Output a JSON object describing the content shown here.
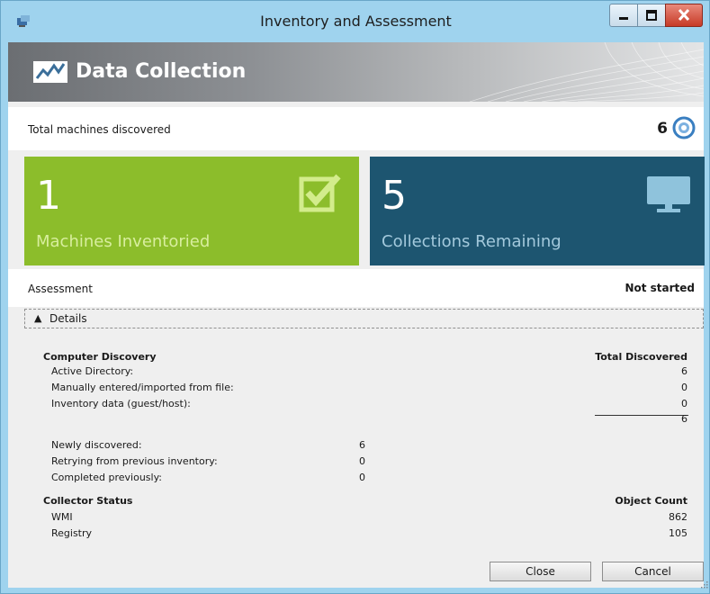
{
  "window": {
    "title": "Inventory and Assessment",
    "icon": "app-icon",
    "controls": [
      "minimize-icon",
      "maximize-icon",
      "close-icon"
    ]
  },
  "header": {
    "title": "Data Collection",
    "icon": "chart-icon"
  },
  "summary": {
    "label": "Total machines discovered",
    "value": "6",
    "icon": "spinner-icon"
  },
  "tiles": [
    {
      "number": "1",
      "label": "Machines Inventoried",
      "icon": "checkbox-icon",
      "color": "#8cbd2b"
    },
    {
      "number": "5",
      "label": "Collections Remaining",
      "icon": "monitor-icon",
      "color": "#1d5570"
    }
  ],
  "assessment": {
    "label": "Assessment",
    "value": "Not started"
  },
  "details": {
    "toggle_label": "Details",
    "discovery": {
      "title": "Computer Discovery",
      "total_header": "Total Discovered",
      "rows": [
        {
          "label": "Active Directory:",
          "value": "6"
        },
        {
          "label": "Manually entered/imported from file:",
          "value": "0"
        },
        {
          "label": "Inventory data (guest/host):",
          "value": "0"
        }
      ],
      "total": "6"
    },
    "status": [
      {
        "label": "Newly discovered:",
        "value": "6"
      },
      {
        "label": "Retrying from previous inventory:",
        "value": "0"
      },
      {
        "label": "Completed previously:",
        "value": "0"
      }
    ],
    "collector": {
      "title": "Collector Status",
      "count_header": "Object Count",
      "rows": [
        {
          "label": "WMI",
          "value": "862"
        },
        {
          "label": "Registry",
          "value": "105"
        }
      ]
    }
  },
  "buttons": {
    "close": "Close",
    "cancel": "Cancel"
  },
  "colors": {
    "accent_green": "#8cbd2b",
    "accent_blue": "#1d5570",
    "chrome_blue": "#9fd3ee"
  }
}
